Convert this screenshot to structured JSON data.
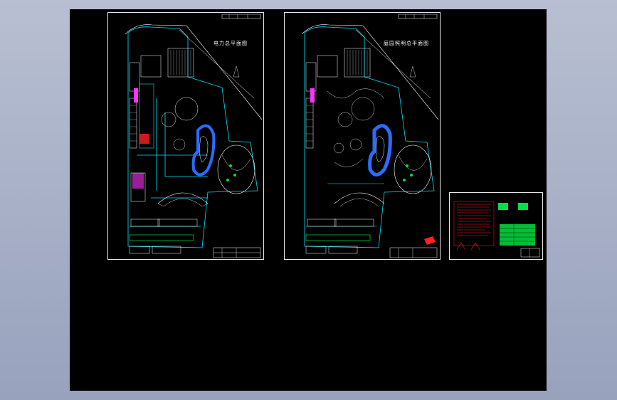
{
  "colors": {
    "background": "#a9b2c8",
    "viewport": "#000000",
    "frame": "#e8e8e8",
    "cyan": "#00e5ff",
    "white": "#ffffff",
    "magenta": "#ff33ff",
    "red": "#ff2020",
    "green": "#00e040",
    "blue": "#2b6cff",
    "yellow": "#f0f000"
  },
  "sheets": [
    {
      "title": "电力总平面图"
    },
    {
      "title": "庭园照明总平面图"
    },
    {
      "title": ""
    }
  ]
}
